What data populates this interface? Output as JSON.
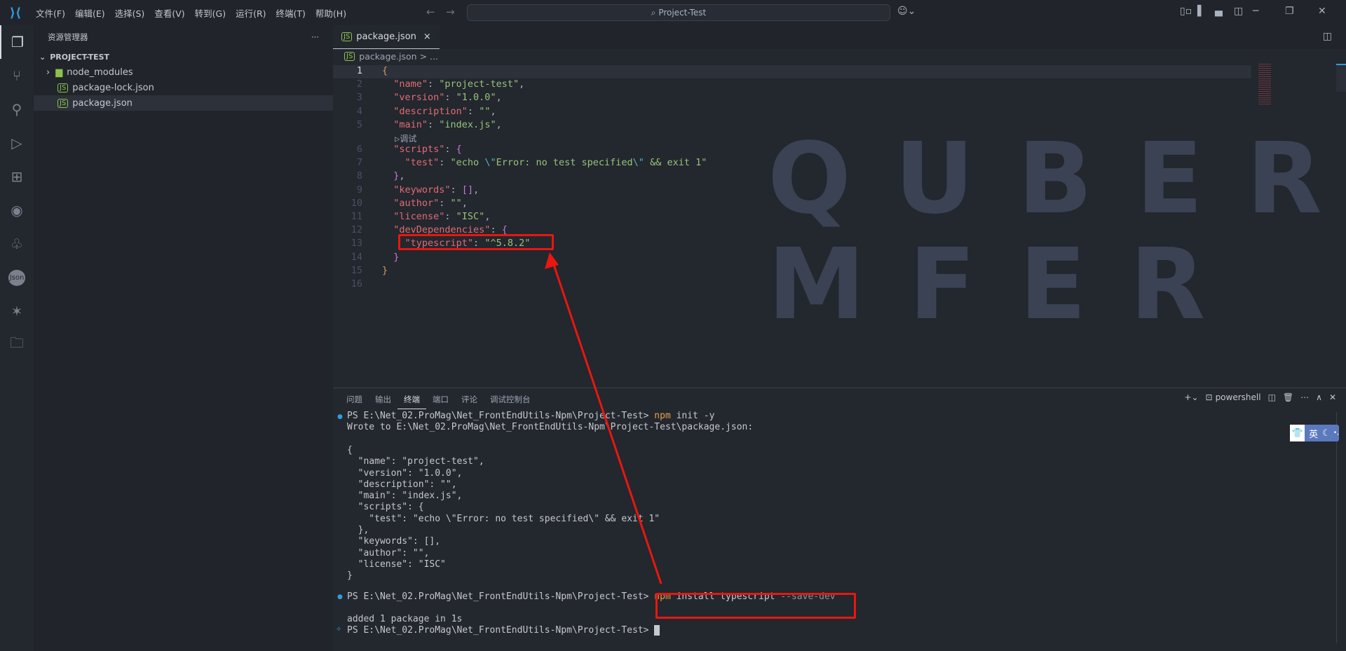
{
  "titlebar": {
    "menus": [
      "文件(F)",
      "编辑(E)",
      "选择(S)",
      "查看(V)",
      "转到(G)",
      "运行(R)",
      "终端(T)",
      "帮助(H)"
    ],
    "search": "Project-Test"
  },
  "sidebar": {
    "title": "资源管理器",
    "more": "···",
    "project": "PROJECT-TEST",
    "items": [
      {
        "label": "node_modules",
        "type": "folder"
      },
      {
        "label": "package-lock.json",
        "type": "json"
      },
      {
        "label": "package.json",
        "type": "json",
        "selected": true
      }
    ]
  },
  "editor": {
    "tab": "package.json",
    "close": "×",
    "breadcrumb": "package.json",
    "breadcrumb_more": "> ...",
    "codelens": "▷调试",
    "line_numbers": [
      "1",
      "2",
      "3",
      "4",
      "5",
      "6",
      "7",
      "8",
      "9",
      "10",
      "11",
      "12",
      "13",
      "14",
      "15",
      "16"
    ],
    "watermark": [
      "QUBER",
      "MFER"
    ]
  },
  "panel": {
    "tabs": [
      "问题",
      "输出",
      "终端",
      "端口",
      "评论",
      "调试控制台"
    ],
    "active_tab": "终端",
    "shell": "powershell",
    "prompt": "PS E:\\Net_02.ProMag\\Net_FrontEndUtils-Npm\\Project-Test> ",
    "cmd1": {
      "npm": "npm",
      "rest": " init -y"
    },
    "output": [
      "Wrote to E:\\Net_02.ProMag\\Net_FrontEndUtils-Npm\\Project-Test\\package.json:",
      "",
      "{",
      "  \"name\": \"project-test\",",
      "  \"version\": \"1.0.0\",",
      "  \"description\": \"\",",
      "  \"main\": \"index.js\",",
      "  \"scripts\": {",
      "    \"test\": \"echo \\\"Error: no test specified\\\" && exit 1\"",
      "  },",
      "  \"keywords\": [],",
      "  \"author\": \"\",",
      "  \"license\": \"ISC\"",
      "}"
    ],
    "cmd2": {
      "npm": "npm",
      "mid": " install typescript ",
      "flag": "--save-dev"
    },
    "result": "added 1 package in 1s"
  },
  "ime": {
    "label": "英"
  },
  "colors": {
    "accent": "#2f9de0",
    "annotation": "#e8170f"
  }
}
